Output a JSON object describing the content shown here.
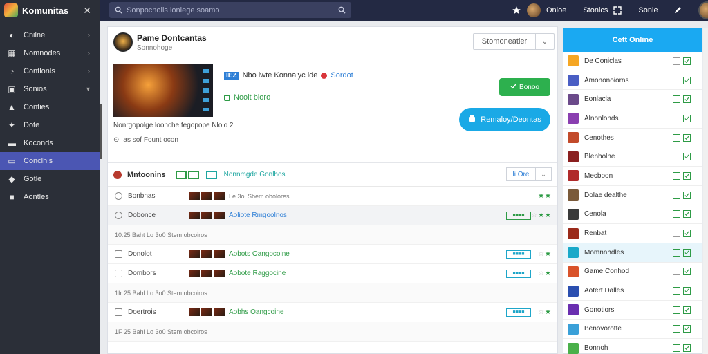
{
  "app": {
    "name": "Komunitas",
    "close_glyph": "✕"
  },
  "search": {
    "placeholder": "Sonpocnoils lonlege soamo"
  },
  "top_nav": {
    "link1": "Onloe",
    "link2": "Stonics",
    "link3": "Sonie"
  },
  "sidebar": {
    "items": [
      {
        "label": "Cnilne",
        "icon": "globe-icon",
        "chev": "›"
      },
      {
        "label": "Nomnodes",
        "icon": "grid-icon",
        "chev": "›"
      },
      {
        "label": "Contlonls",
        "icon": "speech-icon",
        "chev": "›"
      },
      {
        "label": "Sonios",
        "icon": "gamepad-icon",
        "chev": "▾"
      },
      {
        "label": "Conties",
        "icon": "people-icon",
        "chev": ""
      },
      {
        "label": "Dote",
        "icon": "leaf-icon",
        "chev": ""
      },
      {
        "label": "Koconds",
        "icon": "chat-icon",
        "chev": ""
      },
      {
        "label": "Conclhis",
        "icon": "tag-icon",
        "chev": ""
      },
      {
        "label": "Gotle",
        "icon": "tile-icon",
        "chev": ""
      },
      {
        "label": "Aontles",
        "icon": "cube-icon",
        "chev": ""
      }
    ],
    "active_index": 7
  },
  "game": {
    "title": "Pame Dontcantas",
    "subtitle": "Sonnohoge",
    "select_label": "Stomoneatler",
    "select_arrow": "⌄"
  },
  "feature": {
    "tag": "IEZ",
    "title": "Nbo lwte Konnalyc lde",
    "link": "Sordot",
    "status": "Noolt bloro",
    "description": "Nonrgopolge loonche fegopope Nlolo 2",
    "meta_icon": "⊙",
    "meta": "as sof Fount ocon",
    "btn_green": "Bonoo",
    "btn_blue": "Remaloy/Deontas"
  },
  "list": {
    "title": "Mntoonins",
    "filter": "Nonnmgde Gonlhos",
    "view_select": "li Ore",
    "view_arrow": "⌄",
    "rows": [
      {
        "type": "item",
        "check": "circle",
        "name": "Bonbnas",
        "meta": "Le 3ol Sbem obolores",
        "link": "",
        "badge": "",
        "stars": "★★",
        "off": ""
      },
      {
        "type": "item",
        "check": "circle",
        "alt": true,
        "name": "Dobonce",
        "meta": "",
        "link": "Aoliote Rmgoolnos",
        "link_blue": true,
        "badge": "■■■■",
        "badge_green": true,
        "stars": "★★",
        "off": "☆"
      },
      {
        "type": "note",
        "text": "10:25 Baht   Lo 3o0 Stem obcoiros"
      },
      {
        "type": "item",
        "check": "square",
        "name": "Donolot",
        "meta": "",
        "link": "Aobots Oangocoine",
        "badge": "■■■■",
        "stars": "★",
        "off": "☆"
      },
      {
        "type": "item",
        "check": "square",
        "name": "Dombors",
        "meta": "",
        "link": "Aobote Raggocine",
        "badge": "■■■■",
        "stars": "★",
        "off": "☆"
      },
      {
        "type": "note",
        "text": "1Ir 25 Bahl   Lo 3o0 Stem obcoiros"
      },
      {
        "type": "item",
        "check": "square",
        "name": "Doertrois",
        "meta": "",
        "link": "Aobhs Oangcoine",
        "badge": "■■■■",
        "stars": "★",
        "off": "☆"
      },
      {
        "type": "note",
        "text": "1F 25 Bahl   Lo 3o0 Stem obcoiros"
      }
    ]
  },
  "right": {
    "header": "Cett Online",
    "items": [
      {
        "label": "De Coniclas",
        "color": "#f5a623",
        "a": false
      },
      {
        "label": "Amononoiorns",
        "color": "#4a5ec4",
        "a": true
      },
      {
        "label": "Eonlacla",
        "color": "#6b4a8a",
        "a": true
      },
      {
        "label": "Alnonlonds",
        "color": "#8a3fb0",
        "a": true
      },
      {
        "label": "Cenothes",
        "color": "#c24a2a",
        "a": true
      },
      {
        "label": "Blenbolne",
        "color": "#8a1f1f",
        "a": false
      },
      {
        "label": "Mecboon",
        "color": "#b02a2a",
        "a": true
      },
      {
        "label": "Dolae dealthe",
        "color": "#7a5a3a",
        "a": true
      },
      {
        "label": "Cenola",
        "color": "#3a3a3a",
        "a": true
      },
      {
        "label": "Renbat",
        "color": "#9a2a1a",
        "a": false
      },
      {
        "label": "Momnnhdles",
        "color": "#1aa9c9",
        "a": true,
        "active": true
      },
      {
        "label": "Game Conhod",
        "color": "#d9532b",
        "a": false
      },
      {
        "label": "Aotert Dalles",
        "color": "#2b4fb0",
        "a": true
      },
      {
        "label": "Gonotiors",
        "color": "#6a2fb0",
        "a": true
      },
      {
        "label": "Benovorotte",
        "color": "#3aa0d8",
        "a": true
      },
      {
        "label": "Bonnoh",
        "color": "#4ab04a",
        "a": true
      }
    ]
  }
}
